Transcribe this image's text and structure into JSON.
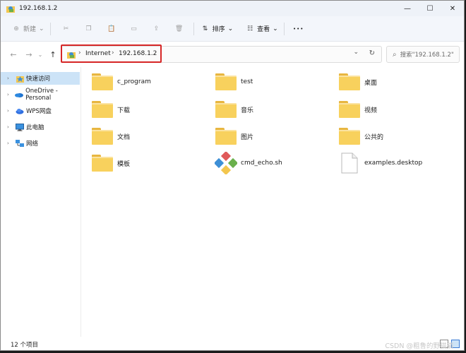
{
  "window": {
    "title": "192.168.1.2",
    "controls": {
      "minimize": "—",
      "maximize": "☐",
      "close": "✕"
    }
  },
  "toolbar": {
    "new_label": "新建",
    "new_glyph": "⊕",
    "dropdown_glyph": "⌄",
    "cut_glyph": "✂",
    "copy_glyph": "❐",
    "paste_glyph": "📋",
    "rename_glyph": "▭",
    "share_glyph": "⇪",
    "delete_glyph": "🗑",
    "sort_label": "排序",
    "sort_glyph": "⇅",
    "view_label": "查看",
    "view_glyph": "☷",
    "more_glyph": "•••"
  },
  "navigation": {
    "back_glyph": "←",
    "forward_glyph": "→",
    "history_glyph": "⌄",
    "up_glyph": "↑",
    "refresh_glyph": "↻",
    "address_dropdown_glyph": "⌄"
  },
  "address": {
    "sep_glyph": "›",
    "crumbs": [
      "Internet",
      "192.168.1.2"
    ]
  },
  "search": {
    "icon_glyph": "⌕",
    "placeholder": "搜索\"192.168.1.2\""
  },
  "sidebar": {
    "chevron_glyph": "›",
    "items": [
      {
        "label": "快速访问",
        "icon": "quick-access-icon",
        "selected": true
      },
      {
        "label": "OneDrive - Personal",
        "icon": "onedrive-icon",
        "selected": false
      },
      {
        "label": "WPS网盘",
        "icon": "wps-cloud-icon",
        "selected": false
      },
      {
        "label": "此电脑",
        "icon": "computer-icon",
        "selected": false
      },
      {
        "label": "网络",
        "icon": "network-icon",
        "selected": false
      }
    ]
  },
  "items": [
    {
      "name": "c_program",
      "type": "folder"
    },
    {
      "name": "test",
      "type": "folder"
    },
    {
      "name": "桌面",
      "type": "folder"
    },
    {
      "name": "下载",
      "type": "folder"
    },
    {
      "name": "音乐",
      "type": "folder"
    },
    {
      "name": "视频",
      "type": "folder"
    },
    {
      "name": "文档",
      "type": "folder"
    },
    {
      "name": "图片",
      "type": "folder"
    },
    {
      "name": "公共的",
      "type": "folder"
    },
    {
      "name": "模板",
      "type": "folder"
    },
    {
      "name": "cmd_echo.sh",
      "type": "script"
    },
    {
      "name": "examples.desktop",
      "type": "file"
    }
  ],
  "status": {
    "item_count": "12 个项目"
  },
  "watermark": "CSDN @粗鲁的野猫猫",
  "colors": {
    "selection": "#cce3f7",
    "highlight_border": "#d62626",
    "folder": "#f8d15d"
  }
}
